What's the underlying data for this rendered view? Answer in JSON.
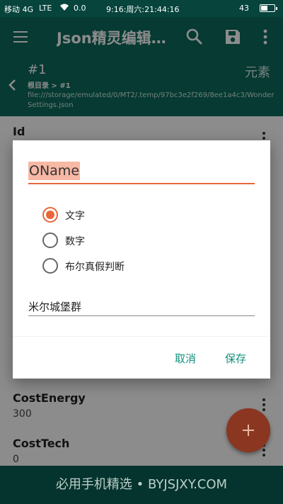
{
  "status_bar": {
    "carrier": "移动 4G",
    "network": "LTE",
    "speed": "0.0",
    "time": "9:16:周六:21:44:16",
    "battery": "43",
    "battery_fraction": 0.43
  },
  "toolbar": {
    "title": "Json精灵编辑…"
  },
  "path_header": {
    "node_title": "#1",
    "node_type": "元素",
    "breadcrumb": "根目录 > #1",
    "file_path": "file:///storage/emulated/0/MT2/.temp/97bc3e2f269/8ee1a4c3/WonderSettings.json"
  },
  "list": {
    "items": [
      {
        "label": "Id",
        "value": ""
      },
      {
        "label": "CostEnergy",
        "value": "300"
      },
      {
        "label": "CostTech",
        "value": "0"
      }
    ]
  },
  "dialog": {
    "field_name": "OName",
    "type_options": [
      {
        "label": "文字",
        "checked": true
      },
      {
        "label": "数字",
        "checked": false
      },
      {
        "label": "布尔真假判断",
        "checked": false
      }
    ],
    "value": "米尔城堡群",
    "cancel_label": "取消",
    "save_label": "保存"
  },
  "banner": {
    "text": "必用手机精选 • BYJSJXY.COM"
  },
  "colors": {
    "primary": "#0b6b5c",
    "accent": "#e8673a",
    "button_text": "#138f7d",
    "fab": "#8a3620"
  }
}
